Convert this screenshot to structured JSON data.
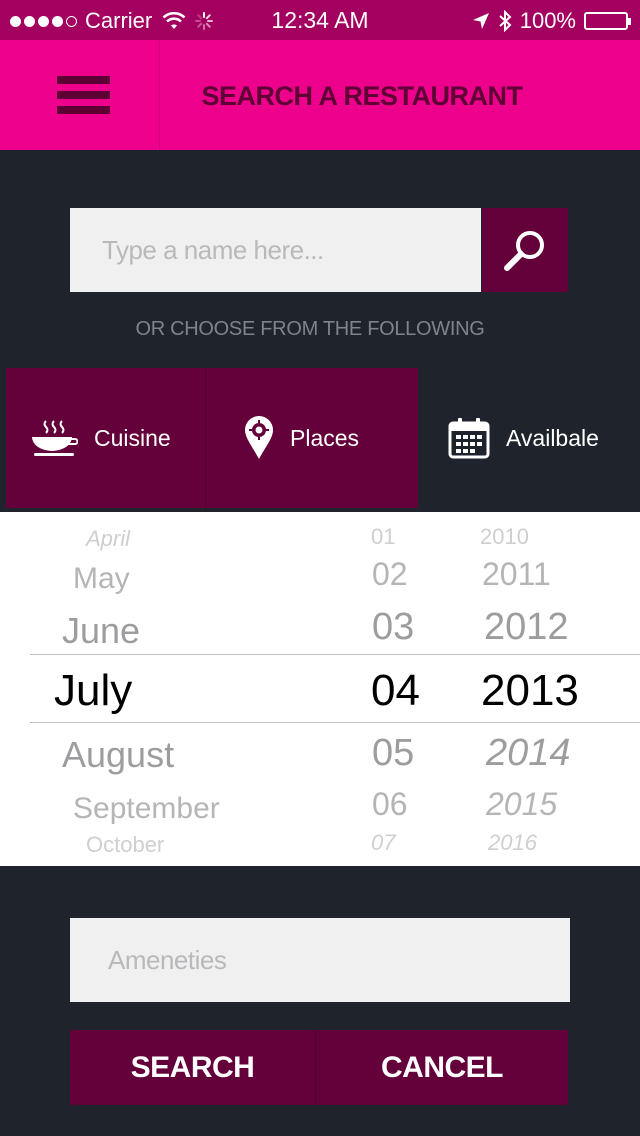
{
  "status_bar": {
    "carrier": "Carrier",
    "time": "12:34 AM",
    "battery": "100%"
  },
  "header": {
    "title": "SEARCH A RESTAURANT"
  },
  "search": {
    "placeholder": "Type a name here..."
  },
  "choose_text": "OR CHOOSE FROM THE FOLLOWING",
  "tabs": [
    {
      "label": "Cuisine",
      "icon": "soup-bowl-icon",
      "active": true
    },
    {
      "label": "Places",
      "icon": "map-pin-icon",
      "active": true
    },
    {
      "label": "Availbale",
      "icon": "calendar-icon",
      "active": false
    }
  ],
  "date_picker": {
    "months": [
      "April",
      "May",
      "June",
      "July",
      "August",
      "September",
      "October"
    ],
    "days": [
      "01",
      "02",
      "03",
      "04",
      "05",
      "06",
      "07"
    ],
    "years": [
      "2010",
      "2011",
      "2012",
      "2013",
      "2014",
      "2015",
      "2016"
    ],
    "selected": {
      "month": "July",
      "day": "04",
      "year": "2013"
    }
  },
  "amenities": {
    "placeholder": "Ameneties"
  },
  "actions": {
    "search_label": "SEARCH",
    "cancel_label": "CANCEL"
  },
  "colors": {
    "header": "#ec008c",
    "status_bar": "#a3005f",
    "accent_dark": "#64003a",
    "background": "#1e232c"
  }
}
